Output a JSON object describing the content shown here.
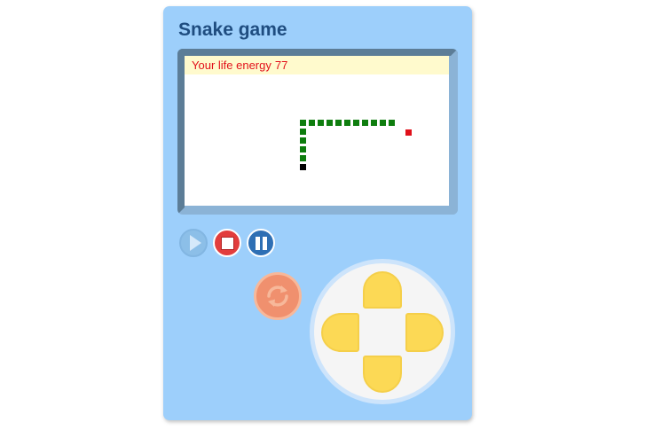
{
  "game": {
    "title": "Snake game",
    "energy_label": "Your life energy",
    "energy_value": "77"
  },
  "controls": {
    "play_icon": "play-icon",
    "stop_icon": "stop-icon",
    "pause_icon": "pause-icon",
    "reset_icon": "refresh-icon"
  },
  "dpad": {
    "up_icon": "arrow-up",
    "down_icon": "arrow-down",
    "left_icon": "arrow-left",
    "right_icon": "arrow-right"
  },
  "colors": {
    "device": "#9dcffb",
    "snake": "#0e7d0e",
    "snake_head": "#000000",
    "food": "#e0101a",
    "energy_bar": "#fffacd",
    "energy_text": "#e2101a",
    "dpad_button": "#fcd955",
    "reset_button": "#f0906e"
  }
}
